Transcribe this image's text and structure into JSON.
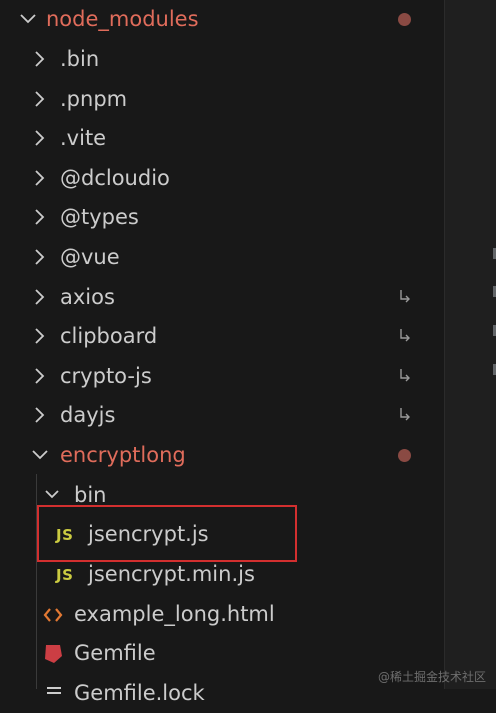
{
  "explorer": {
    "root": {
      "label": "node_modules",
      "expanded": true,
      "modified": true
    },
    "folders": [
      {
        "label": ".bin"
      },
      {
        "label": ".pnpm"
      },
      {
        "label": ".vite"
      },
      {
        "label": "@dcloudio"
      },
      {
        "label": "@types"
      },
      {
        "label": "@vue"
      },
      {
        "label": "axios",
        "symlink": true
      },
      {
        "label": "clipboard",
        "symlink": true
      },
      {
        "label": "crypto-js",
        "symlink": true
      },
      {
        "label": "dayjs",
        "symlink": true
      }
    ],
    "expanded_folder": {
      "label": "encryptlong",
      "expanded": true,
      "modified": true
    },
    "bin_folder": {
      "label": "bin",
      "expanded": true
    },
    "files": [
      {
        "label": "jsencrypt.js",
        "icon": "js-file-icon",
        "icon_text": "JS",
        "highlighted": true
      },
      {
        "label": "jsencrypt.min.js",
        "icon": "js-file-icon",
        "icon_text": "JS"
      },
      {
        "label": "example_long.html",
        "icon": "html-file-icon"
      },
      {
        "label": "Gemfile",
        "icon": "ruby-file-icon"
      },
      {
        "label": "Gemfile.lock",
        "icon": "lock-file-icon"
      }
    ],
    "symlink_glyph": "↳"
  },
  "watermark": "@稀土掘金技术社区",
  "colors": {
    "background": "#181818",
    "text": "#cccccc",
    "modified_text": "#e06c5b",
    "modified_dot": "#8a4a43",
    "js_icon": "#cbcb41",
    "html_icon": "#e37933",
    "ruby_icon": "#cc3e44",
    "highlight_box": "#d32f2f"
  }
}
